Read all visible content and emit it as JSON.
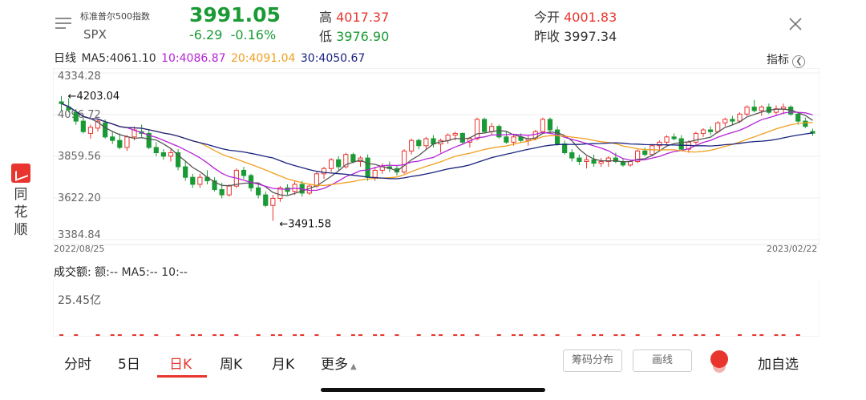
{
  "brand": {
    "text": "同\n花\n顺"
  },
  "header": {
    "name": "标准普尔500指数",
    "code": "SPX",
    "price": "3991.05",
    "change": "-6.29",
    "change_pct": "-0.16%",
    "high_label": "高",
    "high_value": "4017.37",
    "low_label": "低",
    "low_value": "3976.90",
    "open_label": "今开",
    "open_value": "4001.83",
    "prev_label": "昨收",
    "prev_value": "3997.34"
  },
  "ma_legend": {
    "period": "日线",
    "ma5": "MA5:4061.10",
    "ma10": "10:4086.87",
    "ma20": "20:4091.04",
    "ma30": "30:4050.67",
    "indicator_label": "指标"
  },
  "colors": {
    "up": "#e8352e",
    "down": "#1a9a35",
    "ma5": "#555555",
    "ma10": "#b525d8",
    "ma20": "#f0a020",
    "ma30": "#1a237e"
  },
  "chart_data": {
    "type": "candlestick",
    "y_ticks": [
      "4334.28",
      "4096.72",
      "3859.56",
      "3622.20",
      "3384.84"
    ],
    "x_start_label": "2022/08/25",
    "x_end_label": "2023/02/22",
    "annotations": {
      "max_label": "←4203.04",
      "min_label": "←3491.58"
    },
    "ylim": [
      3384.84,
      4334.28
    ],
    "candles": [
      [
        4170,
        4203,
        4120,
        4160
      ],
      [
        4140,
        4190,
        4110,
        4125
      ],
      [
        4110,
        4130,
        4040,
        4060
      ],
      [
        4060,
        4090,
        3990,
        4000
      ],
      [
        3990,
        4040,
        3960,
        4025
      ],
      [
        4020,
        4070,
        4000,
        4060
      ],
      [
        4050,
        4070,
        3960,
        3970
      ],
      [
        3970,
        4000,
        3930,
        3950
      ],
      [
        3950,
        3990,
        3900,
        3910
      ],
      [
        3910,
        3980,
        3890,
        3970
      ],
      [
        3970,
        4030,
        3950,
        4010
      ],
      [
        4000,
        4040,
        3970,
        3990
      ],
      [
        3990,
        4010,
        3900,
        3910
      ],
      [
        3910,
        3940,
        3860,
        3880
      ],
      [
        3880,
        3900,
        3840,
        3860
      ],
      [
        3860,
        3900,
        3830,
        3880
      ],
      [
        3880,
        3900,
        3780,
        3800
      ],
      [
        3800,
        3830,
        3720,
        3740
      ],
      [
        3740,
        3760,
        3680,
        3700
      ],
      [
        3700,
        3760,
        3680,
        3740
      ],
      [
        3740,
        3780,
        3700,
        3720
      ],
      [
        3720,
        3740,
        3660,
        3670
      ],
      [
        3670,
        3710,
        3620,
        3640
      ],
      [
        3640,
        3700,
        3630,
        3690
      ],
      [
        3690,
        3790,
        3680,
        3780
      ],
      [
        3780,
        3800,
        3730,
        3750
      ],
      [
        3750,
        3760,
        3660,
        3680
      ],
      [
        3680,
        3700,
        3620,
        3640
      ],
      [
        3640,
        3660,
        3570,
        3580
      ],
      [
        3580,
        3640,
        3492,
        3620
      ],
      [
        3620,
        3690,
        3600,
        3680
      ],
      [
        3680,
        3700,
        3640,
        3660
      ],
      [
        3660,
        3720,
        3640,
        3700
      ],
      [
        3700,
        3720,
        3630,
        3650
      ],
      [
        3650,
        3700,
        3640,
        3690
      ],
      [
        3690,
        3770,
        3680,
        3760
      ],
      [
        3760,
        3800,
        3730,
        3790
      ],
      [
        3790,
        3850,
        3770,
        3840
      ],
      [
        3840,
        3860,
        3780,
        3800
      ],
      [
        3800,
        3880,
        3790,
        3870
      ],
      [
        3870,
        3880,
        3820,
        3830
      ],
      [
        3830,
        3860,
        3800,
        3850
      ],
      [
        3850,
        3870,
        3720,
        3740
      ],
      [
        3740,
        3800,
        3720,
        3780
      ],
      [
        3780,
        3820,
        3760,
        3800
      ],
      [
        3800,
        3830,
        3770,
        3790
      ],
      [
        3790,
        3810,
        3750,
        3770
      ],
      [
        3770,
        3900,
        3760,
        3890
      ],
      [
        3890,
        3960,
        3870,
        3950
      ],
      [
        3950,
        3960,
        3900,
        3920
      ],
      [
        3920,
        3970,
        3900,
        3960
      ],
      [
        3960,
        3980,
        3910,
        3930
      ],
      [
        3930,
        3960,
        3880,
        3950
      ],
      [
        3950,
        3990,
        3930,
        3980
      ],
      [
        3980,
        4000,
        3950,
        3990
      ],
      [
        3990,
        3995,
        3930,
        3940
      ],
      [
        3940,
        3970,
        3910,
        3960
      ],
      [
        3960,
        4080,
        3950,
        4070
      ],
      [
        4070,
        4080,
        3990,
        4000
      ],
      [
        4000,
        4050,
        3980,
        4030
      ],
      [
        4030,
        4040,
        3960,
        3970
      ],
      [
        3970,
        4000,
        3930,
        3940
      ],
      [
        3940,
        3980,
        3920,
        3970
      ],
      [
        3970,
        3990,
        3940,
        3950
      ],
      [
        3950,
        3980,
        3920,
        3960
      ],
      [
        3960,
        4010,
        3950,
        4000
      ],
      [
        4000,
        4080,
        3990,
        4070
      ],
      [
        4070,
        4080,
        3990,
        4010
      ],
      [
        4010,
        4030,
        3920,
        3930
      ],
      [
        3930,
        3950,
        3870,
        3880
      ],
      [
        3880,
        3900,
        3830,
        3850
      ],
      [
        3850,
        3870,
        3810,
        3830
      ],
      [
        3830,
        3860,
        3790,
        3840
      ],
      [
        3840,
        3870,
        3800,
        3820
      ],
      [
        3820,
        3850,
        3800,
        3830
      ],
      [
        3830,
        3860,
        3800,
        3850
      ],
      [
        3850,
        3880,
        3820,
        3830
      ],
      [
        3830,
        3850,
        3800,
        3810
      ],
      [
        3810,
        3840,
        3800,
        3830
      ],
      [
        3830,
        3900,
        3820,
        3890
      ],
      [
        3890,
        3910,
        3860,
        3870
      ],
      [
        3870,
        3930,
        3860,
        3920
      ],
      [
        3920,
        3950,
        3890,
        3940
      ],
      [
        3940,
        3980,
        3920,
        3970
      ],
      [
        3970,
        3990,
        3950,
        3960
      ],
      [
        3960,
        3980,
        3890,
        3900
      ],
      [
        3900,
        3950,
        3880,
        3940
      ],
      [
        3940,
        4000,
        3920,
        3990
      ],
      [
        3990,
        4020,
        3970,
        4010
      ],
      [
        4010,
        4030,
        3980,
        4000
      ],
      [
        4000,
        4060,
        3990,
        4050
      ],
      [
        4050,
        4080,
        4030,
        4070
      ],
      [
        4070,
        4090,
        4040,
        4060
      ],
      [
        4060,
        4110,
        4050,
        4100
      ],
      [
        4100,
        4150,
        4090,
        4140
      ],
      [
        4140,
        4180,
        4110,
        4120
      ],
      [
        4120,
        4150,
        4090,
        4140
      ],
      [
        4140,
        4160,
        4100,
        4110
      ],
      [
        4110,
        4150,
        4090,
        4130
      ],
      [
        4130,
        4160,
        4100,
        4140
      ],
      [
        4140,
        4150,
        4090,
        4100
      ],
      [
        4100,
        4110,
        4040,
        4060
      ],
      [
        4060,
        4080,
        4020,
        4030
      ],
      [
        4001,
        4017,
        3977,
        3991
      ]
    ]
  },
  "volume": {
    "title_label": "成交额:",
    "title_value": "额:-- MA5:-- 10:--",
    "scale_label": "25.45亿"
  },
  "tabs": [
    "分时",
    "5日",
    "日K",
    "周K",
    "月K",
    "更多"
  ],
  "active_tab": "日K",
  "buttons": {
    "chips": "筹码分布",
    "draw": "画线",
    "add_favorite": "加自选"
  }
}
